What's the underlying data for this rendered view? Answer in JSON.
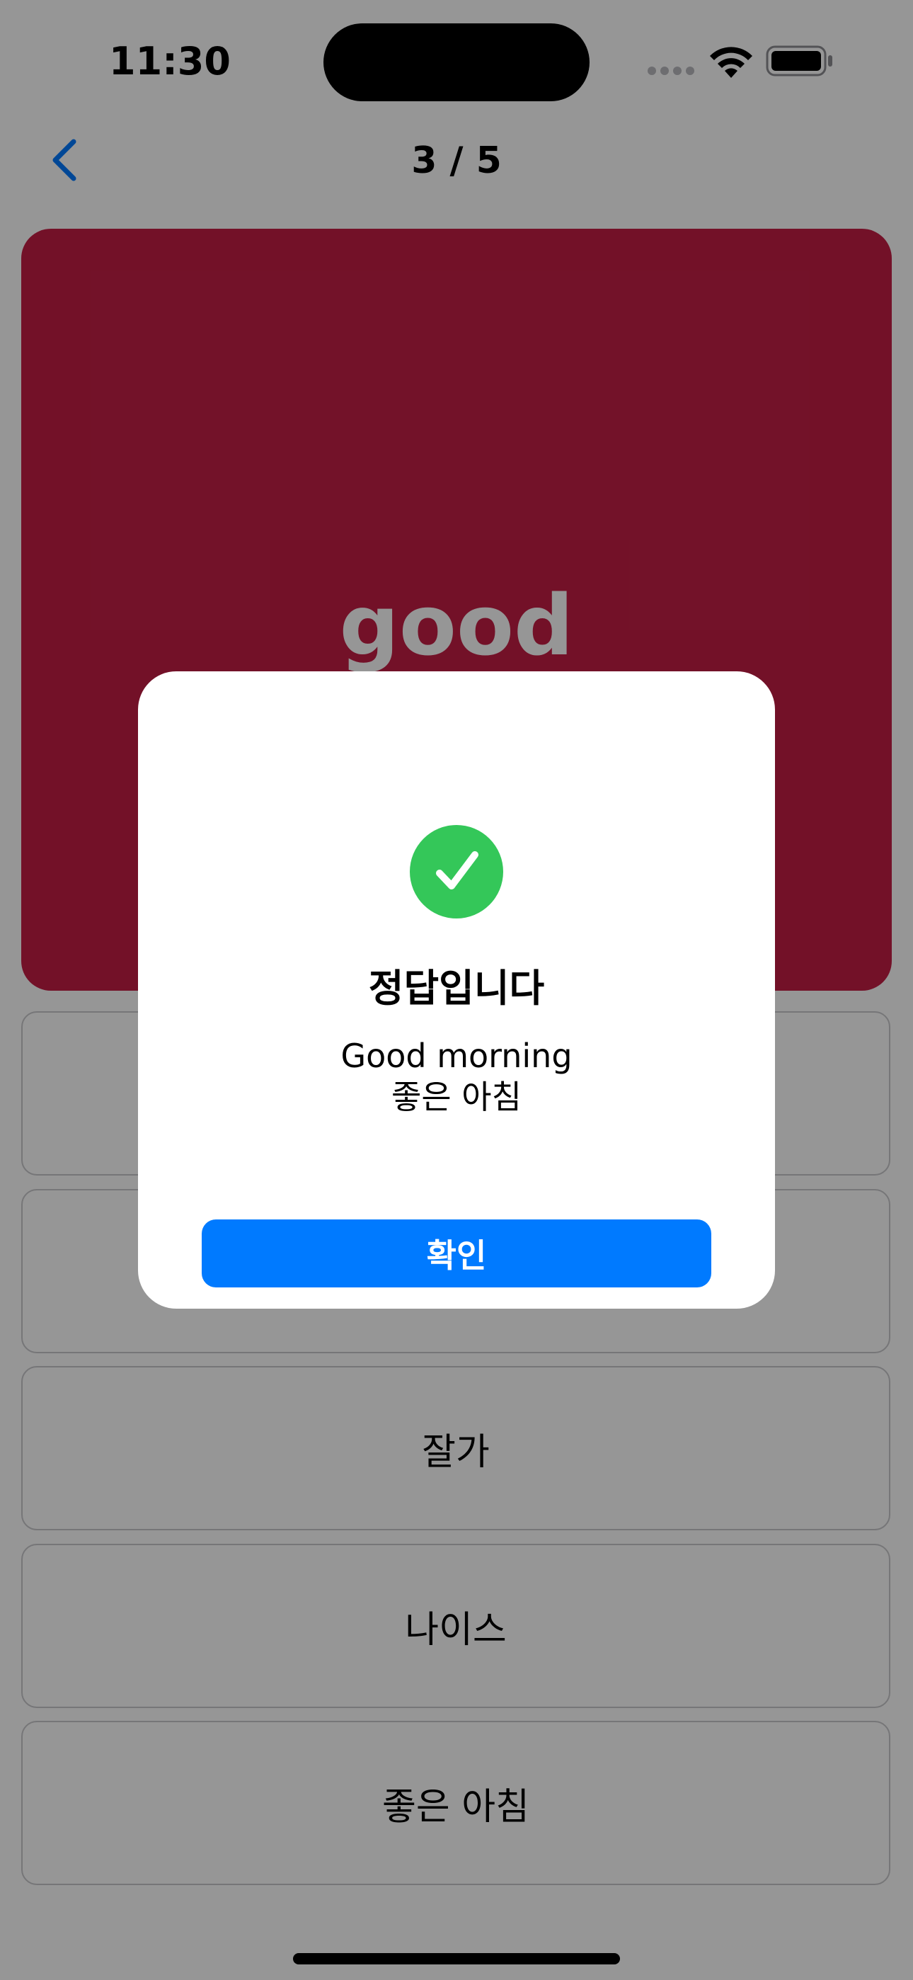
{
  "status_bar": {
    "time": "11:30"
  },
  "nav": {
    "progress": "3 / 5"
  },
  "card": {
    "word": "good",
    "color": "#c41e45"
  },
  "options": [
    {
      "label": ""
    },
    {
      "label": ""
    },
    {
      "label": "잘가"
    },
    {
      "label": "나이스"
    },
    {
      "label": "좋은 아침"
    }
  ],
  "modal": {
    "title": "정답입니다",
    "answer_en": "Good morning",
    "answer_ko": "좋은 아침",
    "confirm_label": "확인",
    "success_color": "#34c759",
    "button_color": "#007aff"
  },
  "icons": {
    "back": "chevron-left-icon",
    "speaker": "speaker-icon",
    "check": "checkmark-icon",
    "wifi": "wifi-icon",
    "battery": "battery-icon"
  }
}
